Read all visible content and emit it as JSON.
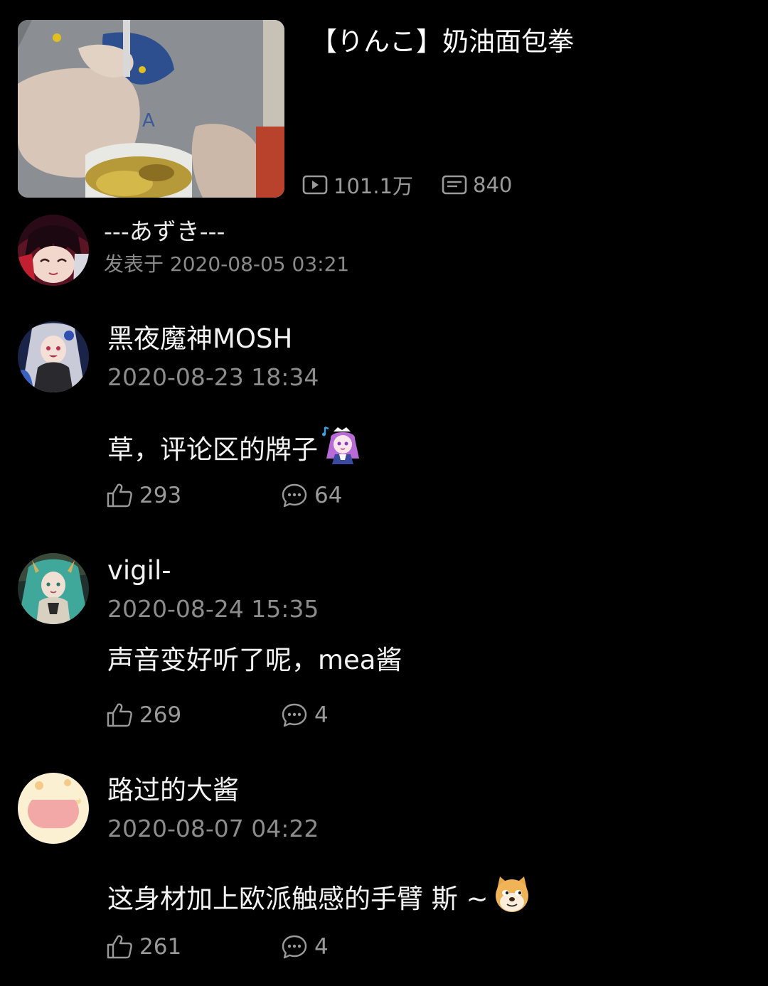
{
  "video": {
    "title": "【りんこ】奶油面包拳",
    "play_count": "101.1万",
    "danmaku_count": "840",
    "play_icon": "play-icon",
    "danmaku_icon": "danmaku-icon"
  },
  "uploader": {
    "name": "---あずき---",
    "posted_at": "发表于 2020-08-05 03:21"
  },
  "comments": [
    {
      "user": "黑夜魔神MOSH",
      "time": "2020-08-23 18:34",
      "text": "草，评论区的牌子",
      "sticker": "anime-girl-sticker",
      "likes": "293",
      "replies": "64"
    },
    {
      "user": "vigil-",
      "time": "2020-08-24 15:35",
      "text": "声音变好听了呢，mea酱",
      "likes": "269",
      "replies": "4"
    },
    {
      "user": "路过的大酱",
      "time": "2020-08-07 04:22",
      "text": "这身材加上欧派触感的手臂  斯 ~",
      "sticker": "doge-emoji",
      "likes": "261",
      "replies": "4"
    }
  ],
  "icons": {
    "like": "thumbs-up-icon",
    "reply": "comment-bubble-icon"
  },
  "colors": {
    "background": "#000000",
    "primary_text": "#f2f2f2",
    "secondary_text": "#8c8c8c",
    "icon": "#999999"
  }
}
